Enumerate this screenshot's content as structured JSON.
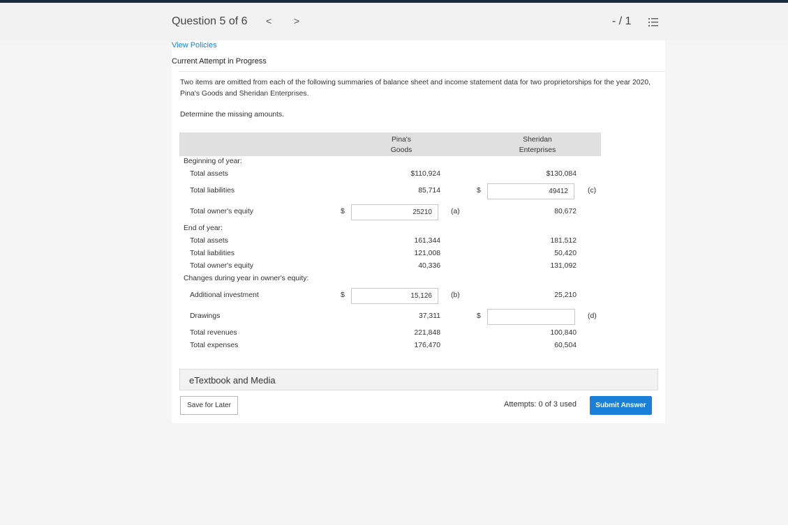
{
  "header": {
    "question_label": "Question 5 of 6",
    "prev_glyph": "<",
    "next_glyph": ">",
    "score": "- / 1"
  },
  "links": {
    "view_policies": "View Policies"
  },
  "status": "Current Attempt in Progress",
  "question": {
    "text": "Two items are omitted from each of the following summaries of balance sheet and income statement data for two proprietorships for the year 2020, Pina's Goods and Sheridan Enterprises.",
    "instruction": "Determine the missing amounts."
  },
  "table": {
    "col1_header_line1": "Pina's",
    "col1_header_line2": "Goods",
    "col2_header_line1": "Sheridan",
    "col2_header_line2": "Enterprises",
    "section_beginning": "Beginning of year:",
    "section_end": "End of year:",
    "section_changes": "Changes during year in owner's equity:",
    "rows": {
      "b_total_assets": {
        "label": "Total assets",
        "c1": "$110,924",
        "c2": "$130,084"
      },
      "b_total_liabilities": {
        "label": "Total liabilities",
        "c1": "85,714",
        "c2_input": "49412",
        "c2_tag": "(c)"
      },
      "b_total_owner_equity": {
        "label": "Total owner's equity",
        "c1_input": "25210",
        "c1_tag": "(a)",
        "c2": "80,672"
      },
      "e_total_assets": {
        "label": "Total assets",
        "c1": "161,344",
        "c2": "181,512"
      },
      "e_total_liabilities": {
        "label": "Total liabilities",
        "c1": "121,008",
        "c2": "50,420"
      },
      "e_total_owner_equity": {
        "label": "Total owner's equity",
        "c1": "40,336",
        "c2": "131,092"
      },
      "additional_investment": {
        "label": "Additional investment",
        "c1_input": "15,126",
        "c1_tag": "(b)",
        "c2": "25,210"
      },
      "drawings": {
        "label": "Drawings",
        "c1": "37,311",
        "c2_input": "",
        "c2_tag": "(d)"
      },
      "total_revenues": {
        "label": "Total revenues",
        "c1": "221,848",
        "c2": "100,840"
      },
      "total_expenses": {
        "label": "Total expenses",
        "c1": "176,470",
        "c2": "60,504"
      }
    },
    "dollar_sign": "$"
  },
  "etextbook": "eTextbook and Media",
  "footer": {
    "save_label": "Save for Later",
    "attempts_text": "Attempts: 0 of 3 used",
    "submit_label": "Submit Answer"
  },
  "colors": {
    "accent": "#1a7fd6",
    "topline": "#1b2a3f"
  }
}
